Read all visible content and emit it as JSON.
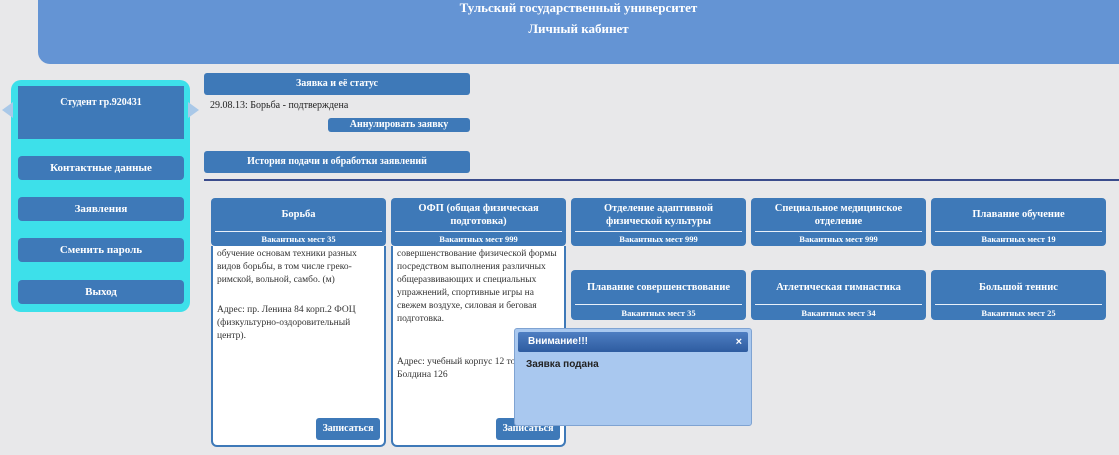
{
  "header": {
    "university": "Тульский государственный университет",
    "section": "Личный кабинет"
  },
  "sidebar": {
    "student": "Студент гр.920431",
    "items": [
      {
        "label": "Контактные данные"
      },
      {
        "label": "Заявления"
      },
      {
        "label": "Сменить пароль"
      },
      {
        "label": "Выход"
      }
    ]
  },
  "application": {
    "title": "Заявка и её статус",
    "status": "29.08.13: Борьба - подтверждена",
    "cancel_label": "Аннулировать заявку",
    "history_label": "История подачи и обработки заявлений"
  },
  "sections": [
    {
      "name": "Борьба",
      "vacancies": "Вакантных мест 35",
      "description": "обучение основам техники разных видов борьбы, в том числе греко-римской, вольной, самбо. (м)",
      "address": "Адрес: пр. Ленина 84 корп.2 ФОЦ (физкультурно-оздоровительный центр).",
      "enroll_label": "Записаться"
    },
    {
      "name": "ОФП (общая физическая подготовка)",
      "vacancies": "Вакантных мест 999",
      "description": "совершенствование физической формы посредством выполнения различных общеразвивающих и специальных упражнений, спортивные игры на свежем воздухе, силовая и беговая подготовка.",
      "address": "Адрес: учебный корпус 12 торца). Ул. Болдина 126",
      "enroll_label": "Записаться"
    },
    {
      "name": "Отделение адаптивной физической культуры",
      "vacancies": "Вакантных мест 999"
    },
    {
      "name": "Специальное медицинское отделение",
      "vacancies": "Вакантных мест 999"
    },
    {
      "name": "Плавание обучение",
      "vacancies": "Вакантных мест 19"
    },
    {
      "name": "Плавание совершенствование",
      "vacancies": "Вакантных мест 35"
    },
    {
      "name": "Атлетическая гимнастика",
      "vacancies": "Вакантных мест 34"
    },
    {
      "name": "Большой теннис",
      "vacancies": "Вакантных мест 25"
    }
  ],
  "modal": {
    "title": "Внимание!!!",
    "close": "×",
    "message": "Заявка подана"
  },
  "icons": {
    "nav_left": "arrow-left-icon",
    "nav_right": "arrow-right-icon",
    "close": "close-icon"
  }
}
